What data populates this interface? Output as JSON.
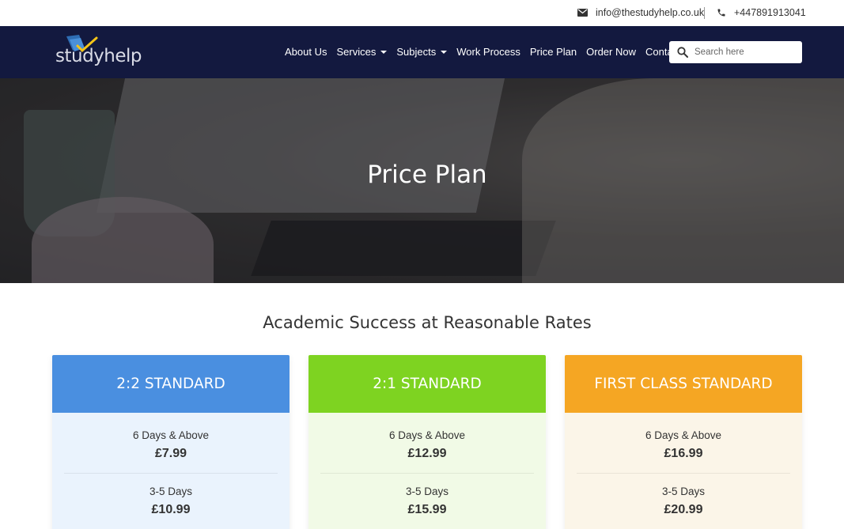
{
  "topbar": {
    "email": "info@thestudyhelp.co.uk",
    "phone": "+447891913041",
    "email_icon": "envelope-icon",
    "phone_icon": "phone-icon"
  },
  "brand": {
    "logo_text": "studyhelp"
  },
  "nav": {
    "items": [
      {
        "label": "About Us",
        "dropdown": false
      },
      {
        "label": "Services",
        "dropdown": true
      },
      {
        "label": "Subjects",
        "dropdown": true
      },
      {
        "label": "Work Process",
        "dropdown": false
      },
      {
        "label": "Price Plan",
        "dropdown": false
      },
      {
        "label": "Order Now",
        "dropdown": false
      },
      {
        "label": "Contact",
        "dropdown": false
      }
    ]
  },
  "search": {
    "placeholder": "Search here",
    "icon": "search-icon"
  },
  "hero": {
    "title": "Price Plan"
  },
  "section": {
    "title": "Academic Success at Reasonable Rates"
  },
  "plans": [
    {
      "name": "2:2 STANDARD",
      "head_color": "#4a8fe0",
      "body_color": "#eaf3fd",
      "tiers": [
        {
          "days": "6 Days & Above",
          "price": "£7.99"
        },
        {
          "days": "3-5 Days",
          "price": "£10.99"
        }
      ]
    },
    {
      "name": "2:1 STANDARD",
      "head_color": "#7ed321",
      "body_color": "#f1fae6",
      "tiers": [
        {
          "days": "6 Days & Above",
          "price": "£12.99"
        },
        {
          "days": "3-5 Days",
          "price": "£15.99"
        }
      ]
    },
    {
      "name": "FIRST CLASS STANDARD",
      "head_color": "#f5a623",
      "body_color": "#fbf5e8",
      "tiers": [
        {
          "days": "6 Days & Above",
          "price": "£16.99"
        },
        {
          "days": "3-5 Days",
          "price": "£20.99"
        }
      ]
    }
  ]
}
